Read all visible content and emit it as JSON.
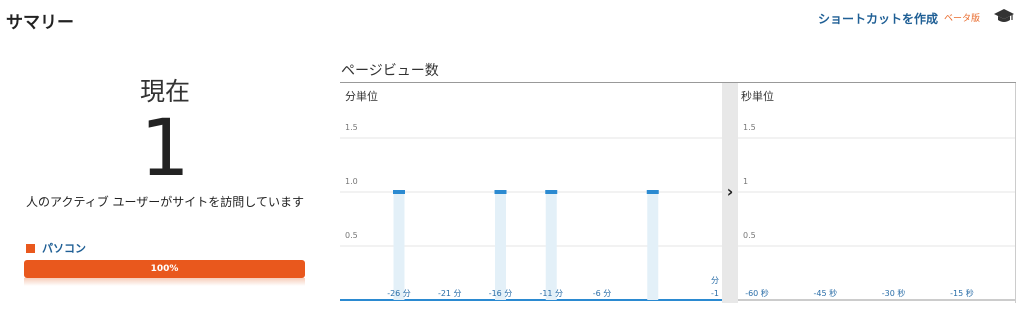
{
  "header": {
    "title": "サマリー",
    "shortcut_label": "ショートカットを作成",
    "beta_label": "ベータ版"
  },
  "realtime": {
    "now_label": "現在",
    "active_users": "1",
    "description": "人のアクティブ ユーザーがサイトを訪問しています"
  },
  "device": {
    "label": "パソコン",
    "percent": 100,
    "percent_label": "100%",
    "color": "#e9581d"
  },
  "pageviews": {
    "title": "ページビュー数",
    "expand_icon": "chevron-right-icon"
  },
  "chart_data": [
    {
      "type": "bar",
      "title": "分単位",
      "y_ticks": [
        "1.5",
        "1.0",
        "0.5"
      ],
      "ylim": [
        0,
        1.5
      ],
      "x_tick_labels": [
        "-26 分",
        "-21 分",
        "-16 分",
        "-11 分",
        "-6 分"
      ],
      "x_last_label": [
        "分",
        "-1"
      ],
      "bars": [
        {
          "minute": -26,
          "value": 1
        },
        {
          "minute": -16,
          "value": 1
        },
        {
          "minute": -11,
          "value": 1
        },
        {
          "minute": -1,
          "value": 1
        }
      ],
      "bar_color": "#2b8ad1",
      "bar_fill_color": "#e3f0f8"
    },
    {
      "type": "bar",
      "title": "秒単位",
      "y_ticks": [
        "1.5",
        "1",
        "0.5"
      ],
      "ylim": [
        0,
        1.5
      ],
      "x_tick_labels": [
        "-60 秒",
        "-45 秒",
        "-30 秒",
        "-15 秒"
      ],
      "bars": []
    }
  ]
}
